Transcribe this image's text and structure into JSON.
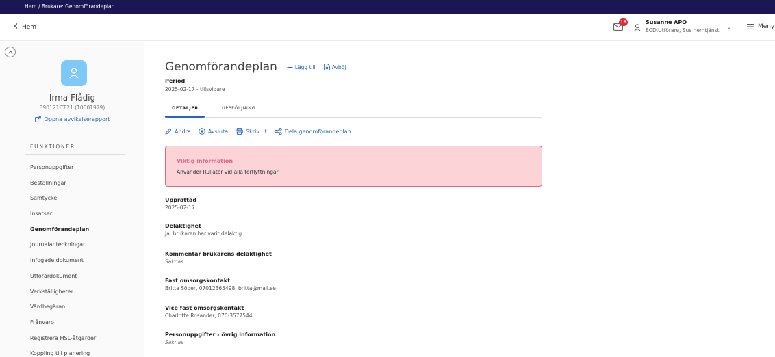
{
  "breadcrumb": "Hem / Brukare: Genomförandeplan",
  "header": {
    "back_label": "Hem",
    "mail_count": "16",
    "user_name": "Susanne APO",
    "user_role": "ECD,Utförare, Sus hemtjänst",
    "menu_label": "Meny"
  },
  "patient": {
    "name": "Irma Flådig",
    "id": "390121-TF21 (10001979)",
    "report_link": "Öppna avvikelserapport"
  },
  "sidebar": {
    "heading": "FUNKTIONER",
    "items": [
      {
        "label": "Personuppgifter"
      },
      {
        "label": "Beställningar"
      },
      {
        "label": "Samtycke"
      },
      {
        "label": "Insatser"
      },
      {
        "label": "Genomförandeplan"
      },
      {
        "label": "Journalanteckningar"
      },
      {
        "label": "Infogade dokument"
      },
      {
        "label": "Utförardokument"
      },
      {
        "label": "Verkställigheter"
      },
      {
        "label": "Vårdbegäran"
      },
      {
        "label": "Frånvaro"
      },
      {
        "label": "Registrera HSL-åtgärder"
      },
      {
        "label": "Koppling till planering"
      }
    ]
  },
  "main": {
    "title": "Genomförandeplan",
    "add_label": "Lägg till",
    "reject_label": "Avböj",
    "period_label": "Period",
    "period_value": "2025-02-17 - tillsvidare",
    "tabs": [
      {
        "label": "DETALJER"
      },
      {
        "label": "UPPFÖLJNING"
      }
    ],
    "actions": [
      {
        "label": "Ändra"
      },
      {
        "label": "Avsluta"
      },
      {
        "label": "Skriv ut"
      },
      {
        "label": "Dela genomförandeplan"
      }
    ],
    "alert": {
      "title": "Viktig information",
      "text": "Använder Rullator vid alla förflyttningar"
    },
    "fields": [
      {
        "label": "Upprättad",
        "value": "2025-02-17"
      },
      {
        "label": "Delaktighet",
        "value": "Ja, brukaren har varit delaktig"
      },
      {
        "label": "Kommentar brukarens delaktighet",
        "value": "Saknas"
      },
      {
        "label": "Fast omsorgskontakt",
        "value": "Britta Söder, 07012365498, britta@mail.se"
      },
      {
        "label": "Vice fast omsorgskontakt",
        "value": "Charlotte Rosander, 070-3577544"
      },
      {
        "label": "Personuppgifter - övrig information",
        "value": "Saknas"
      }
    ]
  },
  "colors": {
    "topbar": "#1a1754",
    "accent": "#2566c2",
    "alert_bg": "#fcd4d7",
    "alert_border": "#e06a75",
    "badge": "#d6303c",
    "avatar": "#7ec9f7"
  }
}
